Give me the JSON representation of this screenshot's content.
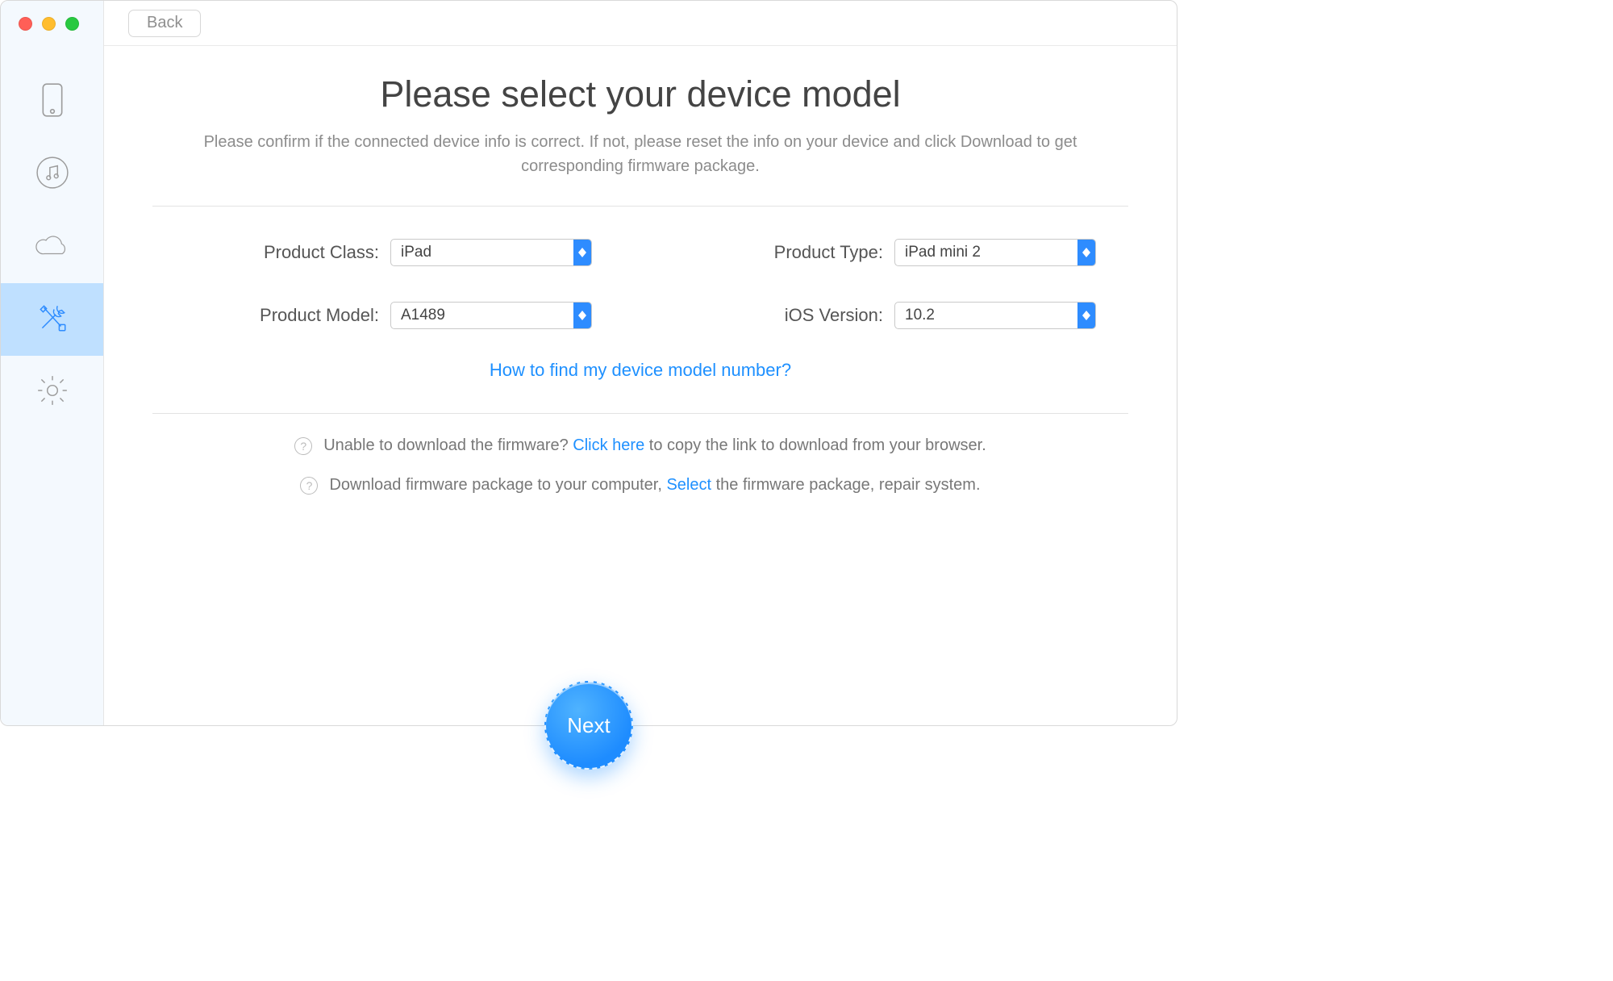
{
  "header": {
    "back_label": "Back"
  },
  "sidebar": {
    "items": [
      {
        "name": "phone-icon"
      },
      {
        "name": "music-icon"
      },
      {
        "name": "cloud-icon"
      },
      {
        "name": "tools-icon"
      },
      {
        "name": "gear-icon"
      }
    ],
    "active_index": 3
  },
  "main": {
    "title": "Please select your device model",
    "subtitle": "Please confirm if the connected device info is correct. If not, please reset the info on your device and click Download to get corresponding firmware package."
  },
  "fields": {
    "product_class": {
      "label": "Product Class:",
      "value": "iPad"
    },
    "product_type": {
      "label": "Product Type:",
      "value": "iPad mini 2"
    },
    "product_model": {
      "label": "Product Model:",
      "value": "A1489"
    },
    "ios_version": {
      "label": "iOS Version:",
      "value": "10.2"
    }
  },
  "help_link": "How to find my device model number?",
  "tips": {
    "row1": {
      "before": "Unable to download the firmware? ",
      "link": "Click here",
      "after": " to copy the link to download from your browser."
    },
    "row2": {
      "before": "Download firmware package to your computer, ",
      "link": "Select",
      "after": " the firmware package, repair system."
    }
  },
  "next_label": "Next"
}
